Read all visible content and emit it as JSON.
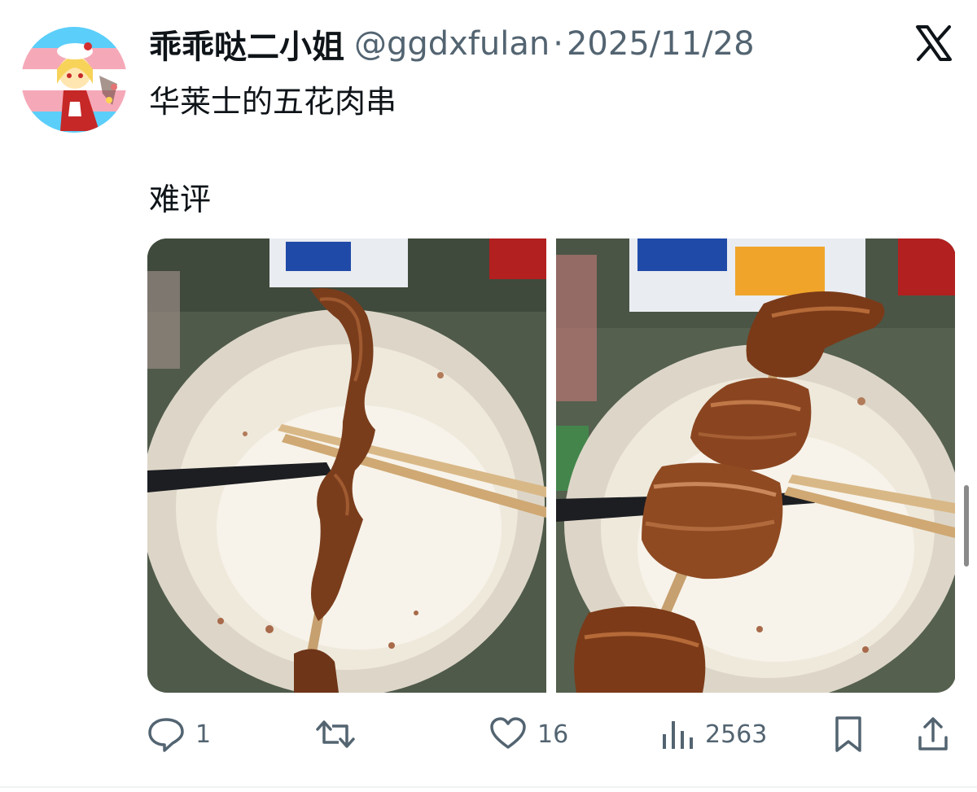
{
  "tweet": {
    "author": {
      "display_name": "乖乖哒二小姐",
      "handle": "@ggdxfulan",
      "separator": "·",
      "date": "2025/11/28",
      "avatar_icon": "anime-avatar"
    },
    "text_lines": [
      "华莱士的五花肉串",
      "难评"
    ],
    "media": [
      {
        "description_icon": "pork-belly-skewer-photo-1"
      },
      {
        "description_icon": "pork-belly-skewer-photo-2"
      }
    ],
    "actions": {
      "reply_count": "1",
      "retweet_count": "",
      "like_count": "16",
      "views_count": "2563"
    }
  },
  "colors": {
    "text_primary": "#0f1419",
    "text_secondary": "#536471",
    "border": "#eff3f4"
  }
}
